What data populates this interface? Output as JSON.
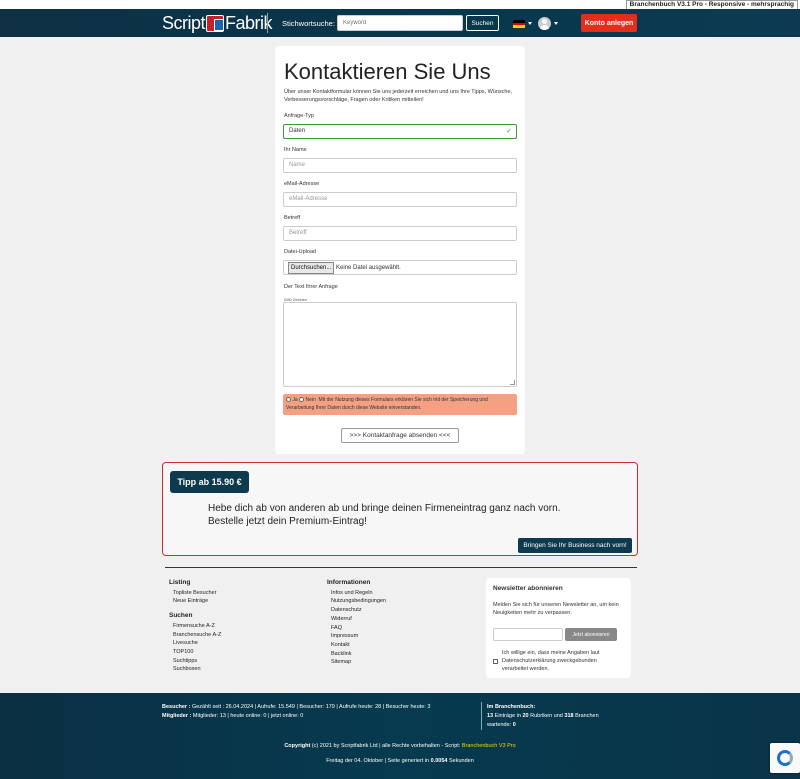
{
  "version_badge": "Branchenbuch V3.1 Pro - Responsive - mehrsprachig",
  "header": {
    "logo_left": "Script",
    "logo_right": "Fabrik",
    "search_label": "Stichwortsuche:",
    "search_placeholder": "Keyword",
    "search_button": "Suchen",
    "register_button": "Konto anlegen",
    "language_icon": "german-flag-icon",
    "user_icon": "user-avatar-icon"
  },
  "contact_form": {
    "title": "Kontaktieren Sie Uns",
    "intro": "Über unser Kontaktformular können Sie uns jederzeit erreichen und uns Ihre Tipps, Wünsche, Verbesserungsvorschläge, Fragen oder Kritiken mitteilen!",
    "request_type_label": "Anfrage-Typ",
    "request_type_value": "Daten",
    "name_label": "Ihr Name",
    "name_placeholder": "Name",
    "email_label": "eMail-Adresse",
    "email_placeholder": "eMail-Adresse",
    "subject_label": "Betreff",
    "subject_placeholder": "Betreff",
    "upload_label": "Datei-Upload",
    "upload_button": "Durchsuchen...",
    "upload_status": "Keine Datei ausgewählt.",
    "message_label": "Der Text Ihrer Anfrage",
    "char_counter": "0/80 Zeichen",
    "consent_yes": "Ja",
    "consent_no": "Nein",
    "consent_text": "Mit der Nutzung dieses Formulars erklären Sie sich mit der Speicherung und Verarbeitung Ihrer Daten durch diese Website einverstanden.",
    "submit_button": ">>> Kontaktanfrage absenden <<<"
  },
  "promo": {
    "tag": "Tipp ab 15.90 €",
    "line1": "Hebe dich ab von anderen ab und bringe deinen Firmeneintrag ganz nach vorn.",
    "line2": "Bestelle jetzt dein Premium-Eintrag!",
    "button": "Bringen Sie Ihr Business nach vorn!"
  },
  "footer_links": {
    "listing_heading": "Listing",
    "listing": [
      "Topliste Besucher",
      "Neue Einträge"
    ],
    "search_heading": "Suchen",
    "search": [
      "Firmensuche A-Z",
      "Branchensuche A-Z",
      "Livesuche",
      "TOP100",
      "Suchtipps",
      "Suchboxen"
    ],
    "info_heading": "Informationen",
    "info": [
      "Infos und Regeln",
      "Nutzungsbedingungen",
      "Datenschutz",
      "Widerruf",
      "FAQ",
      "Impressum",
      "Kontakt",
      "Backlink",
      "Sitemap"
    ]
  },
  "newsletter": {
    "heading": "Newsletter abonnieren",
    "description": "Melden Sie sich für unseren Newsletter an, um kein Neuigkeiten mehr zu verpassen.",
    "button": "Jetzt abonnieren",
    "consent": "Ich willige ein, dass meine Angaben laut Datenschutzerklärung zweckgebunden verarbeitet werden."
  },
  "footer": {
    "visitors_label": "Besucher :",
    "visitors_text": "Gezählt seit : 26.04.2024 | Aufrufe: 15.549 | Besucher: 179 | Aufrufe heute: 28 | Besucher heute: 3",
    "members_label": "Mitglieder :",
    "members_text": "Mitglieder: 13 | heute online: 0 | jetzt online: 0",
    "biz_label": "Im Branchenbuch:",
    "biz_n1": "13",
    "biz_t1": " Einträge in ",
    "biz_n2": "20",
    "biz_t2": " Rubriken und ",
    "biz_n3": "318",
    "biz_t3": " Branchen",
    "biz_waiting_label": "wartende: ",
    "biz_waiting": "0",
    "copyright_label": "Copyright",
    "copyright_text": " (c) 2021 by Scriptfabrik Ltd | alle Rechte vorbehalten - Script: ",
    "copyright_link": "Branchenbuch V3 Pro",
    "date_text": "Freitag der 04. Oktober | Seite generiert in ",
    "gen_time": "0.0054",
    "gen_unit": " Sekunden"
  }
}
